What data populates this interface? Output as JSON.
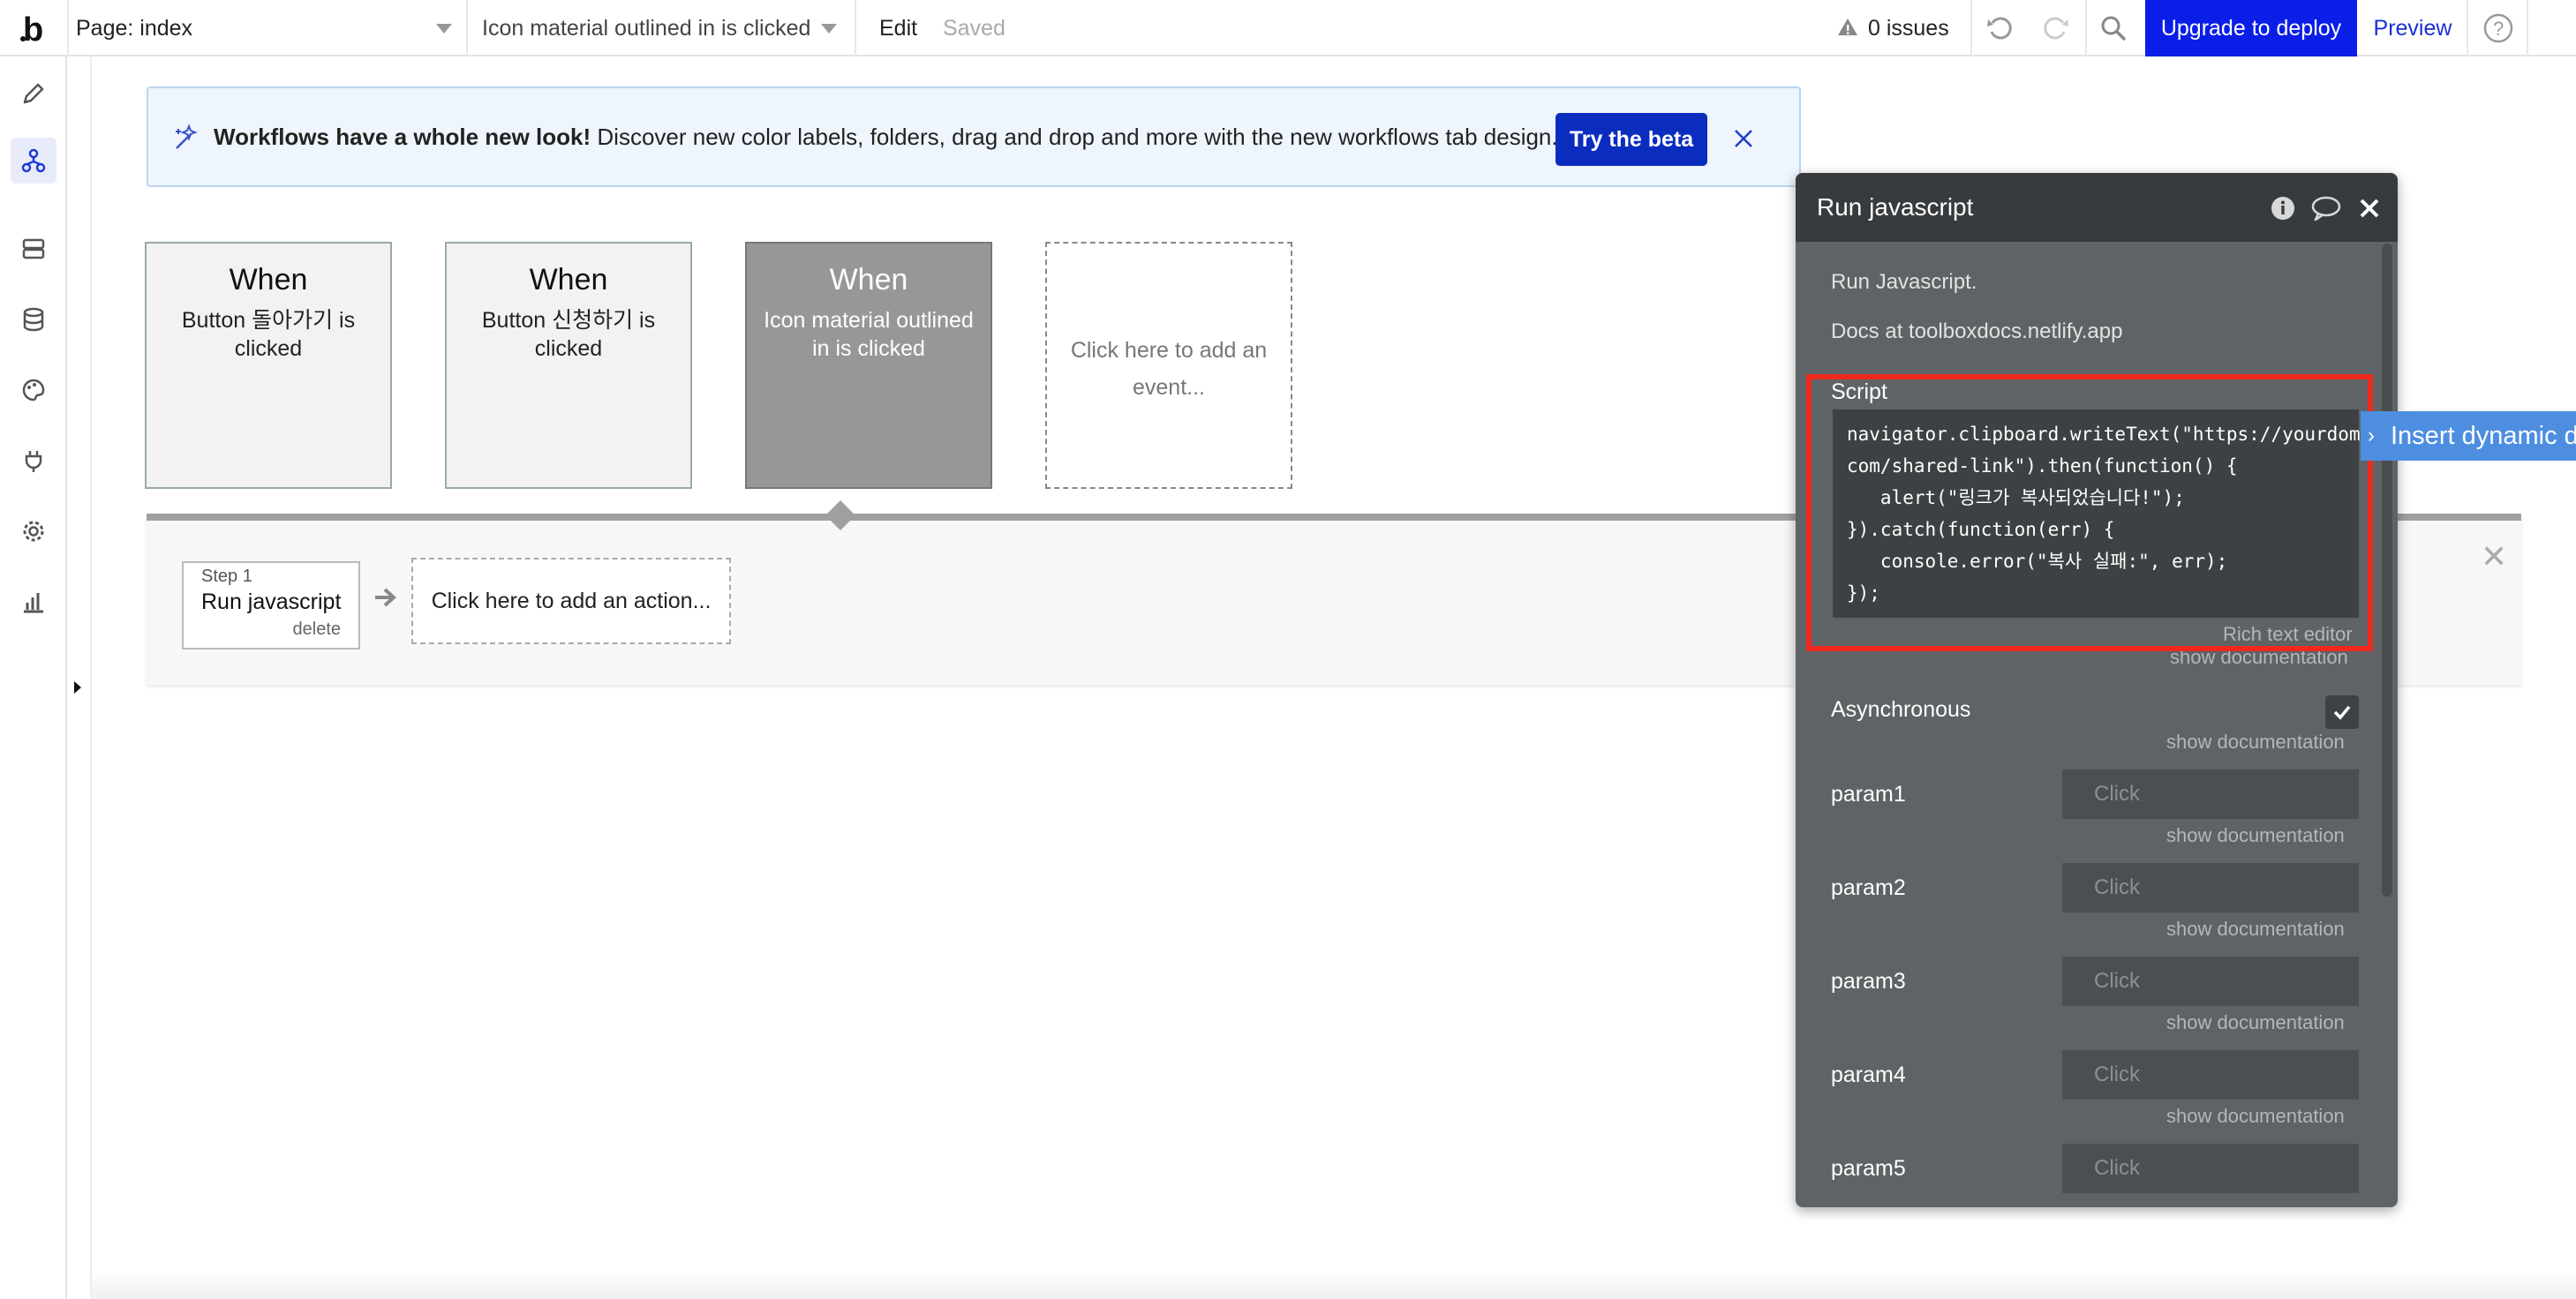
{
  "topbar": {
    "page_label": "Page: index",
    "event_label": "Icon material outlined in is clicked",
    "edit_label": "Edit",
    "saved_label": "Saved",
    "issues_label": "0 issues",
    "upgrade_label": "Upgrade to deploy",
    "preview_label": "Preview"
  },
  "banner": {
    "bold_text": "Workflows have a whole new look!",
    "text": " Discover new color labels, folders, drag and drop and more with the new workflows tab design.",
    "button_label": "Try the beta"
  },
  "events": [
    {
      "when": "When",
      "desc": "Button 돌아가기 is clicked"
    },
    {
      "when": "When",
      "desc": "Button 신청하기 is clicked"
    },
    {
      "when": "When",
      "desc": "Icon material outlined in is clicked"
    },
    {
      "desc": "Click here to add an event..."
    }
  ],
  "actions": {
    "step_label": "Step 1",
    "step_name": "Run javascript",
    "delete_label": "delete",
    "add_label": "Click here to add an action..."
  },
  "panel": {
    "title": "Run javascript",
    "desc1": "Run Javascript.",
    "desc2": "Docs at toolboxdocs.netlify.app",
    "script_label": "Script",
    "script_lines": [
      "navigator.clipboard.writeText(\"https://yourdomain.",
      "com/shared-link\").then(function() {",
      "   alert(\"링크가 복사되었습니다!\");",
      "}).catch(function(err) {",
      "   console.error(\"복사 실패:\", err);",
      "});"
    ],
    "rich_text_label": "Rich text editor",
    "show_doc": "show documentation",
    "async_label": "Asynchronous",
    "async_checked": true,
    "params": [
      {
        "label": "param1",
        "placeholder": "Click"
      },
      {
        "label": "param2",
        "placeholder": "Click"
      },
      {
        "label": "param3",
        "placeholder": "Click"
      },
      {
        "label": "param4",
        "placeholder": "Click"
      },
      {
        "label": "param5",
        "placeholder": "Click"
      }
    ],
    "insert_dynamic": "Insert dynamic data"
  },
  "colors": {
    "accent": "#0b1ee8",
    "highlight": "#ee2a1e",
    "panel_bg": "#5f6365",
    "insert_dynamic_bg": "#4d8ee0"
  },
  "icons": [
    "bubble-logo",
    "pencil-icon",
    "workflow-icon",
    "data-icon",
    "database-icon",
    "palette-icon",
    "plugin-icon",
    "settings-icon",
    "logs-icon",
    "warning-icon",
    "undo-icon",
    "redo-icon",
    "search-icon",
    "help-icon",
    "sparkle-icon",
    "close-icon",
    "info-icon",
    "comment-icon",
    "check-icon",
    "arrow-right-icon"
  ]
}
